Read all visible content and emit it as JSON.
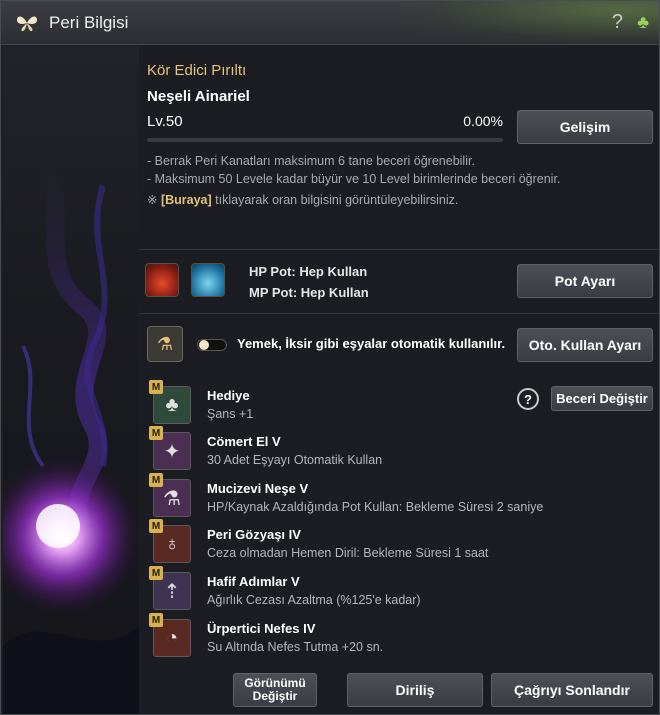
{
  "window": {
    "title": "Peri Bilgisi",
    "help_glyph": "?",
    "clover_glyph": "♣"
  },
  "header": {
    "subtitle": "Kör Edici Pırıltı",
    "fairy_name": "Neşeli Ainariel",
    "level": "Lv.50",
    "progress_text": "0.00%",
    "progress_fraction": 0.0,
    "upgrade_button": "Gelişim"
  },
  "info": {
    "line1": "- Berrak Peri Kanatları maksimum 6 tane beceri öğrenebilir.",
    "line2": "- Maksimum 50 Levele kadar büyür ve 10 Level birimlerinde beceri öğrenir.",
    "note_prefix": "※ ",
    "note_link": "[Buraya]",
    "note_suffix": " tıklayarak oran bilgisini görüntüleyebilirsiniz."
  },
  "potions": {
    "hp_label": "HP Pot: Hep Kullan",
    "mp_label": "MP Pot: Hep Kullan",
    "settings_button": "Pot Ayarı"
  },
  "auto_use": {
    "text": "Yemek, İksir gibi eşyalar otomatik kullanılır.",
    "toggle_on": false,
    "settings_button": "Oto. Kullan Ayarı"
  },
  "skills_panel": {
    "change_button": "Beceri Değiştir",
    "help_glyph": "?"
  },
  "skills": [
    {
      "badge": "M",
      "name": "Hediye",
      "desc": "Şans +1",
      "icon": "clover-icon",
      "glyph": "♣",
      "color": "#2d4a3a"
    },
    {
      "badge": "M",
      "name": "Cömert El V",
      "desc": "30 Adet Eşyayı Otomatik Kullan",
      "icon": "fairy-icon",
      "glyph": "✦",
      "color": "#4a2f52"
    },
    {
      "badge": "M",
      "name": "Mucizevi Neşe V",
      "desc": "HP/Kaynak Azaldığında Pot Kullan: Bekleme Süresi 2 saniye",
      "icon": "potion-icon",
      "glyph": "⚗",
      "color": "#4a2f52"
    },
    {
      "badge": "M",
      "name": "Peri Gözyaşı IV",
      "desc": "Ceza olmadan Hemen Diril: Bekleme Süresi 1 saat",
      "icon": "tear-icon",
      "glyph": "♁",
      "color": "#5a2a22"
    },
    {
      "badge": "M",
      "name": "Hafif Adımlar V",
      "desc": "Ağırlık Cezası Azaltma (%125'e kadar)",
      "icon": "weight-icon",
      "glyph": "⇡",
      "color": "#3e3350"
    },
    {
      "badge": "M",
      "name": "Ürpertici Nefes IV",
      "desc": "Su Altında Nefes Tutma +20 sn.",
      "icon": "breath-icon",
      "glyph": "◔",
      "color": "#5a2a22"
    }
  ],
  "footer": {
    "appearance_button": "Görünümü Değiştir",
    "revive_button": "Diriliş",
    "dismiss_button": "Çağrıyı Sonlandır"
  }
}
